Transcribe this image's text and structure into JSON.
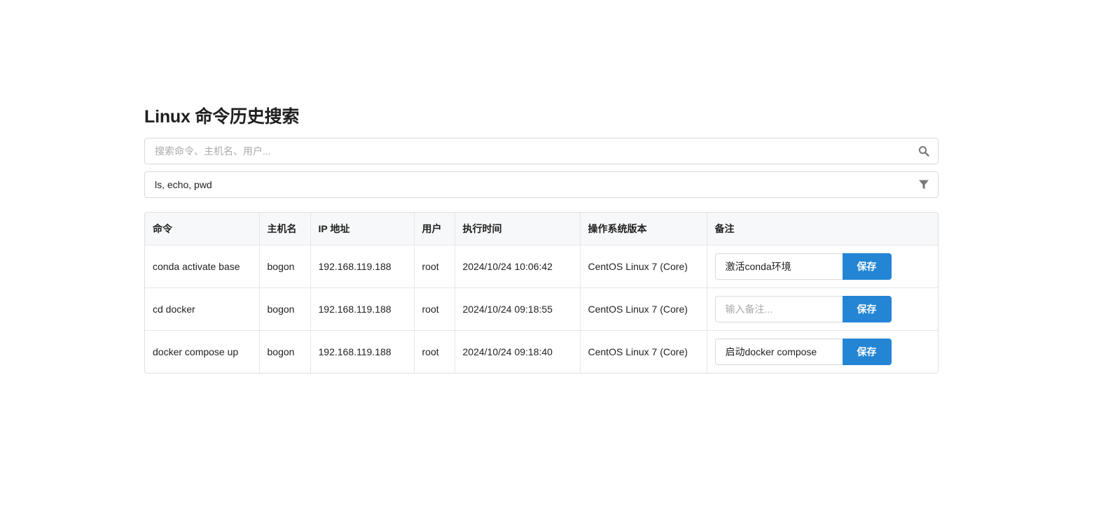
{
  "page": {
    "title": "Linux 命令历史搜索"
  },
  "search": {
    "placeholder": "搜索命令、主机名、用户...",
    "value": "",
    "icon": "search-icon"
  },
  "filter": {
    "value": "ls, echo, pwd",
    "icon": "filter-icon"
  },
  "table": {
    "columns": [
      "命令",
      "主机名",
      "IP 地址",
      "用户",
      "执行时间",
      "操作系统版本",
      "备注"
    ],
    "rows": [
      {
        "command": "conda activate base",
        "hostname": "bogon",
        "ip": "192.168.119.188",
        "user": "root",
        "time": "2024/10/24 10:06:42",
        "os": "CentOS Linux 7 (Core)",
        "remark": "激活conda环境",
        "remark_placeholder": "输入备注...",
        "save_label": "保存"
      },
      {
        "command": "cd docker",
        "hostname": "bogon",
        "ip": "192.168.119.188",
        "user": "root",
        "time": "2024/10/24 09:18:55",
        "os": "CentOS Linux 7 (Core)",
        "remark": "",
        "remark_placeholder": "输入备注...",
        "save_label": "保存"
      },
      {
        "command": "docker compose up",
        "hostname": "bogon",
        "ip": "192.168.119.188",
        "user": "root",
        "time": "2024/10/24 09:18:40",
        "os": "CentOS Linux 7 (Core)",
        "remark": "启动docker compose",
        "remark_placeholder": "输入备注...",
        "save_label": "保存"
      }
    ]
  },
  "colors": {
    "accent": "#2385d4",
    "header_bg": "#f7f8fa",
    "border": "#dedede",
    "icon": "#7a7a7a"
  }
}
